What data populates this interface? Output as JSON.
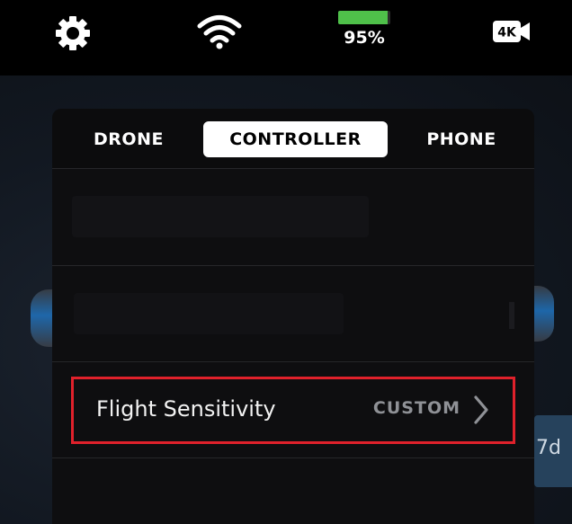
{
  "status_bar": {
    "battery_percent_label": "95%",
    "battery_level": 0.95,
    "video_badge": "4K",
    "icons": [
      "gear-icon",
      "wifi-icon",
      "battery-icon",
      "video-4k-icon"
    ],
    "battery_color": "#4fc04a"
  },
  "tabs": {
    "items": [
      {
        "label": "DRONE",
        "selected": false
      },
      {
        "label": "CONTROLLER",
        "selected": true
      },
      {
        "label": "PHONE",
        "selected": false
      }
    ]
  },
  "settings": {
    "flight_sensitivity": {
      "label": "Flight Sensitivity",
      "value": "CUSTOM",
      "icon": "chevron-right-icon"
    }
  },
  "background": {
    "side_chip_text": "7d"
  },
  "colors": {
    "highlight_border": "#e0212b",
    "tab_selected_bg": "#ffffff",
    "value_text": "#8f9196"
  }
}
